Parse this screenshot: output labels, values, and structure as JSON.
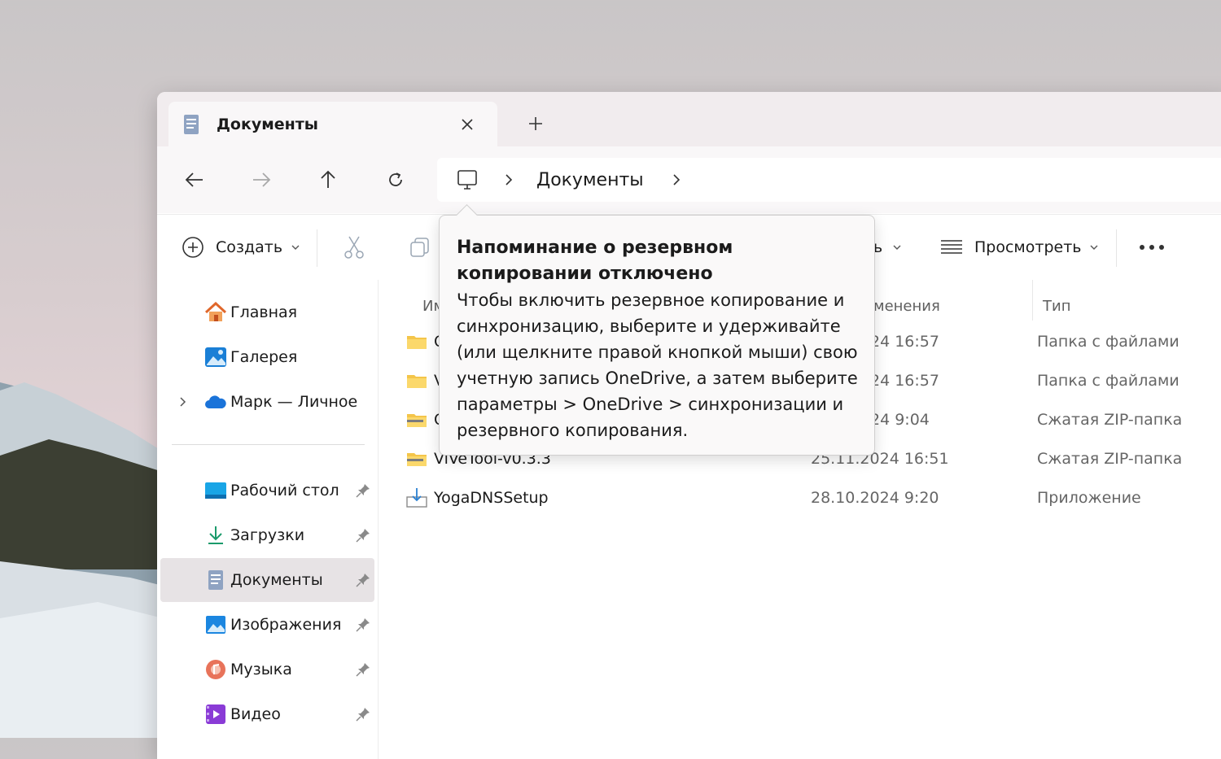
{
  "tab": {
    "title": "Документы"
  },
  "address": {
    "segment": "Документы"
  },
  "commands": {
    "create": "Создать",
    "partial_label": "ь",
    "view": "Просмотреть"
  },
  "sidebar": {
    "quick": [
      {
        "label": "Главная"
      },
      {
        "label": "Галерея"
      },
      {
        "label": "Марк — Личное"
      }
    ],
    "pinned": [
      {
        "label": "Рабочий стол"
      },
      {
        "label": "Загрузки"
      },
      {
        "label": "Документы"
      },
      {
        "label": "Изображения"
      },
      {
        "label": "Музыка"
      },
      {
        "label": "Видео"
      }
    ]
  },
  "columns": {
    "name_partial": "Им",
    "date_partial": "менения",
    "type": "Тип"
  },
  "files": [
    {
      "name_partial": "С",
      "date": "24 16:57",
      "type": "Папка с файлами",
      "icon": "folder-icon"
    },
    {
      "name_partial": "V",
      "date": "24 16:57",
      "type": "Папка с файлами",
      "icon": "folder-icon"
    },
    {
      "name_partial": "С",
      "date": "24 9:04",
      "type": "Сжатая ZIP-папка",
      "icon": "zip-folder-icon"
    },
    {
      "name": "ViVeTool-v0.3.3",
      "date": "25.11.2024 16:51",
      "type": "Сжатая ZIP-папка",
      "icon": "zip-folder-icon"
    },
    {
      "name": "YogaDNSSetup",
      "date": "28.10.2024 9:20",
      "type": "Приложение",
      "icon": "installer-icon"
    }
  ],
  "tooltip": {
    "title": "Напоминание о резервном копировании отключено",
    "body": "Чтобы включить резервное копирование и синхронизацию, выберите и удерживайте (или щелкните правой кнопкой мыши) свою учетную запись OneDrive, а затем выберите параметры > OneDrive > синхронизации и резервного копирования."
  },
  "colors": {
    "accent": "#0067c0",
    "folder": "#f4c54a",
    "active_item": "#e7e3e5"
  }
}
